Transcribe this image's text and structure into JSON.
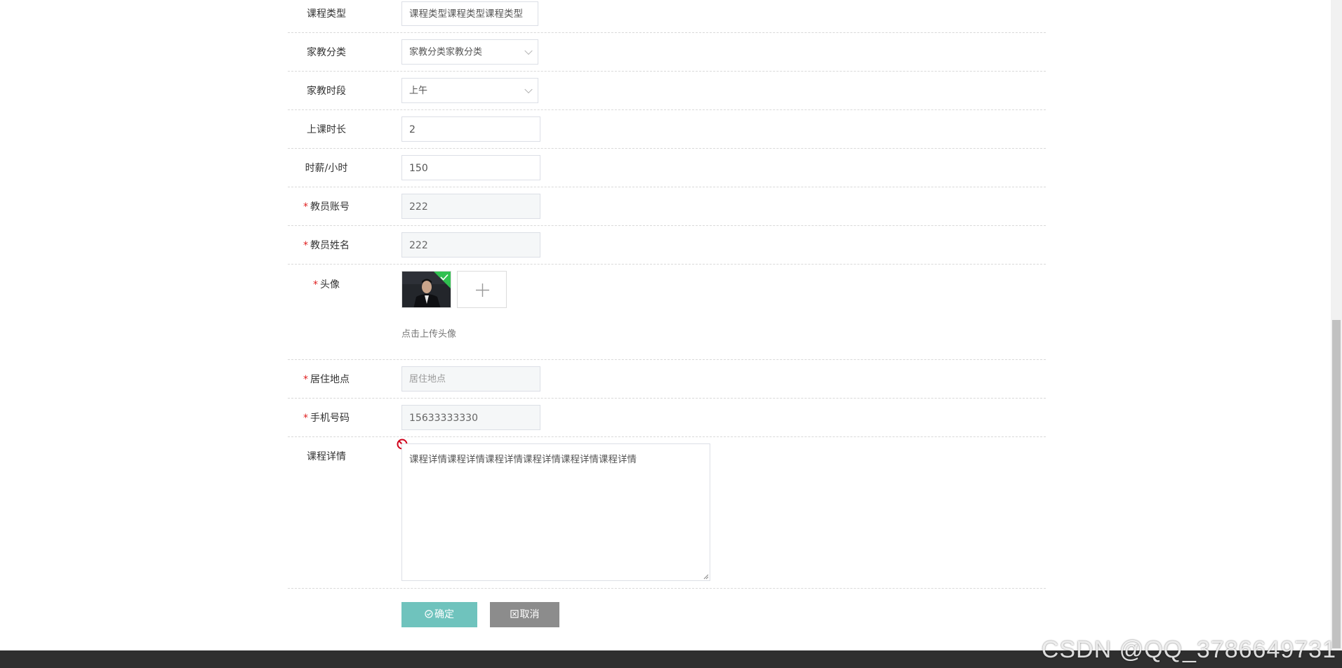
{
  "form": {
    "course_type": {
      "label": "课程类型",
      "value": "课程类型课程类型课程类型"
    },
    "tutor_category": {
      "label": "家教分类",
      "value": "家教分类家教分类"
    },
    "tutor_period": {
      "label": "家教时段",
      "value": "上午"
    },
    "class_duration": {
      "label": "上课时长",
      "value": "2"
    },
    "hourly_pay": {
      "label": "时薪/小时",
      "value": "150"
    },
    "teacher_account": {
      "label": "教员账号",
      "value": "222",
      "required": "*"
    },
    "teacher_name": {
      "label": "教员姓名",
      "value": "222",
      "required": "*"
    },
    "avatar": {
      "label": "头像",
      "required": "*",
      "hint": "点击上传头像"
    },
    "residence": {
      "label": "居住地点",
      "placeholder": "居住地点",
      "required": "*"
    },
    "phone": {
      "label": "手机号码",
      "value": "15633333330",
      "required": "*"
    },
    "course_detail": {
      "label": "课程详情",
      "value": "课程详情课程详情课程详情课程详情课程详情课程详情"
    }
  },
  "buttons": {
    "confirm": "确定",
    "cancel": "取消"
  },
  "watermark": "CSDN @QQ_3786649731",
  "colors": {
    "confirm_bg": "#6fc3bd",
    "cancel_bg": "#8c8c8c",
    "required": "#e02020",
    "upload_success": "#30c050",
    "blocked_icon": "#d0021b"
  },
  "icons": {
    "upload_add": "plus-icon",
    "upload_ok": "check-icon",
    "not_allowed": "no-entry-icon",
    "confirm": "circle-check-icon",
    "cancel": "box-x-icon"
  }
}
